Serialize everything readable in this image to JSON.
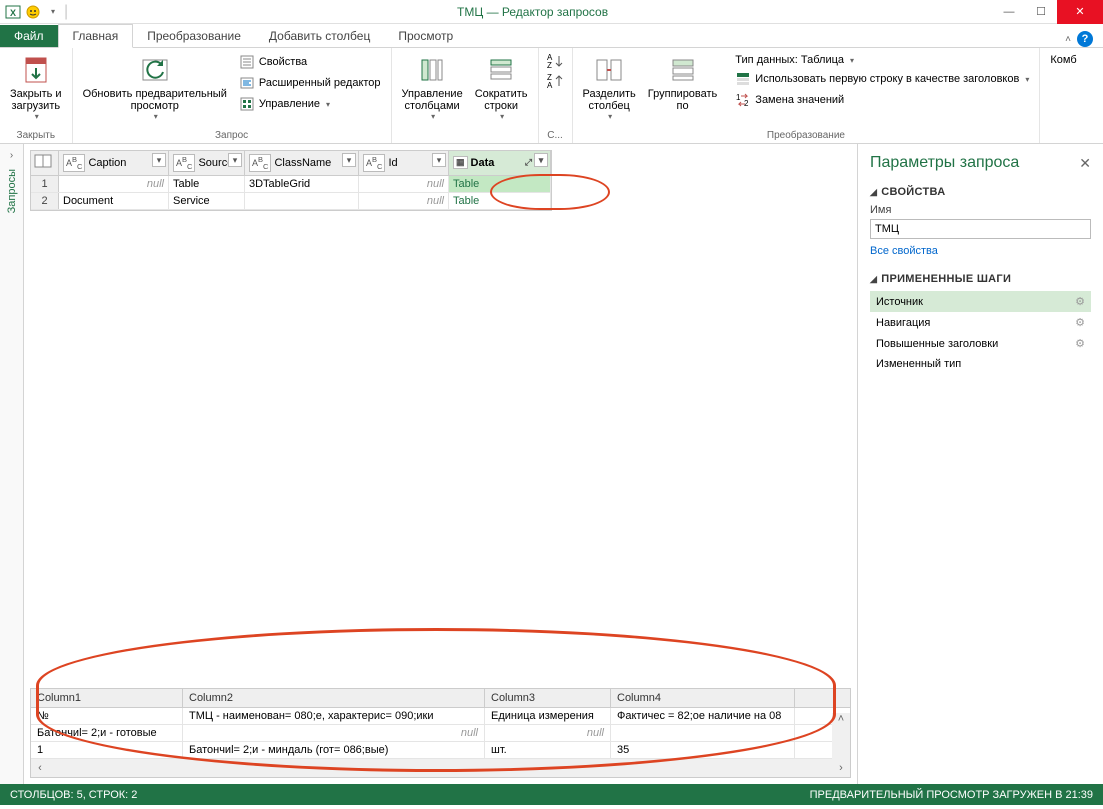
{
  "window": {
    "title": "ТМЦ — Редактор запросов"
  },
  "tabs": {
    "file": "Файл",
    "home": "Главная",
    "transform": "Преобразование",
    "addcolumn": "Добавить столбец",
    "view": "Просмотр"
  },
  "ribbon": {
    "close": {
      "label": "Закрыть и\nзагрузить",
      "group": "Закрыть"
    },
    "refresh": {
      "label": "Обновить предварительный\nпросмотр"
    },
    "props": "Свойства",
    "adv": "Расширенный редактор",
    "manage": "Управление",
    "query_group": "Запрос",
    "cols": "Управление\nстолбцами",
    "rows": "Сократить\nстроки",
    "sort_group": "С...",
    "split": "Разделить\nстолбец",
    "groupby": "Группировать\nпо",
    "dtype": "Тип данных: Таблица",
    "firstrow": "Использовать первую строку в качестве заголовков",
    "replace": "Замена значений",
    "transform_group": "Преобразование",
    "combine": "Комб"
  },
  "sidebar_label": "Запросы",
  "grid": {
    "columns": [
      "Caption",
      "Source",
      "ClassName",
      "Id",
      "Data"
    ],
    "rows": [
      {
        "n": "1",
        "caption": "null",
        "source": "Table",
        "class": "3DTableGrid",
        "id": "null",
        "data": "Table"
      },
      {
        "n": "2",
        "caption": "Document",
        "source": "Service",
        "class": "",
        "id": "null",
        "data": "Table"
      }
    ]
  },
  "preview": {
    "columns": [
      "Column1",
      "Column2",
      "Column3",
      "Column4"
    ],
    "rows": [
      [
        "№",
        "ТМЦ - наименован= 080;е, характерис= 090;ики",
        "Единица измерения",
        "Фактичес = 82;ое наличие на 08"
      ],
      [
        "Батончиl= 2;и - готовые",
        "null",
        "null",
        ""
      ],
      [
        "1",
        "Батончиl= 2;и - миндаль  (гот= 086;вые)",
        "шт.",
        "35"
      ]
    ]
  },
  "rightpanel": {
    "title": "Параметры запроса",
    "props_section": "СВОЙСТВА",
    "name_label": "Имя",
    "name_value": "ТМЦ",
    "all_props": "Все свойства",
    "steps_section": "ПРИМЕНЕННЫЕ ШАГИ",
    "steps": [
      "Источник",
      "Навигация",
      "Повышенные заголовки",
      "Измененный тип"
    ]
  },
  "statusbar": {
    "left": "СТОЛБЦОВ: 5, СТРОК: 2",
    "right": "ПРЕДВАРИТЕЛЬНЫЙ ПРОСМОТР ЗАГРУЖЕН В 21:39"
  }
}
